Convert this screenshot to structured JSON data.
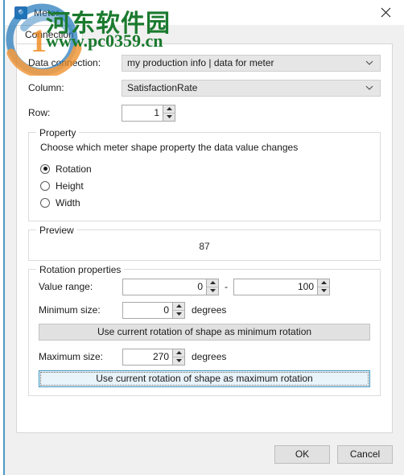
{
  "window": {
    "title": "Meter",
    "app_icon": "meter-app-icon",
    "close_icon": "close-icon"
  },
  "tabs": [
    {
      "label": "Connection",
      "active": true
    }
  ],
  "form": {
    "data_connection": {
      "label": "Data connection:",
      "value": "my production info | data for meter",
      "icon": "chevron-down-icon"
    },
    "column": {
      "label": "Column:",
      "value": "SatisfactionRate",
      "icon": "chevron-down-icon"
    },
    "row": {
      "label": "Row:",
      "value": "1"
    }
  },
  "property_group": {
    "title": "Property",
    "description": "Choose which meter shape property the data value changes",
    "options": [
      {
        "label": "Rotation",
        "selected": true
      },
      {
        "label": "Height",
        "selected": false
      },
      {
        "label": "Width",
        "selected": false
      }
    ]
  },
  "preview_group": {
    "title": "Preview",
    "value": "87"
  },
  "rotation_group": {
    "title": "Rotation properties",
    "value_range": {
      "label": "Value range:",
      "min": "0",
      "max": "100",
      "separator": "-"
    },
    "minimum_size": {
      "label": "Minimum size:",
      "value": "0",
      "unit": "degrees"
    },
    "min_rotation_button": "Use current rotation of shape as minimum rotation",
    "maximum_size": {
      "label": "Maximum size:",
      "value": "270",
      "unit": "degrees"
    },
    "max_rotation_button": "Use current rotation of shape as maximum rotation"
  },
  "footer": {
    "ok_label": "OK",
    "cancel_label": "Cancel"
  },
  "watermark": {
    "chinese_text": "河东软件园",
    "url_text": "www.pc0359.cn",
    "color": "#1a7a2e"
  },
  "colors": {
    "accent": "#4a9ac4",
    "focus_border": "#3c94bd",
    "focus_fill": "#e9f3fa",
    "dialog_bg": "#f0f0f0",
    "panel_bg": "#ffffff"
  }
}
